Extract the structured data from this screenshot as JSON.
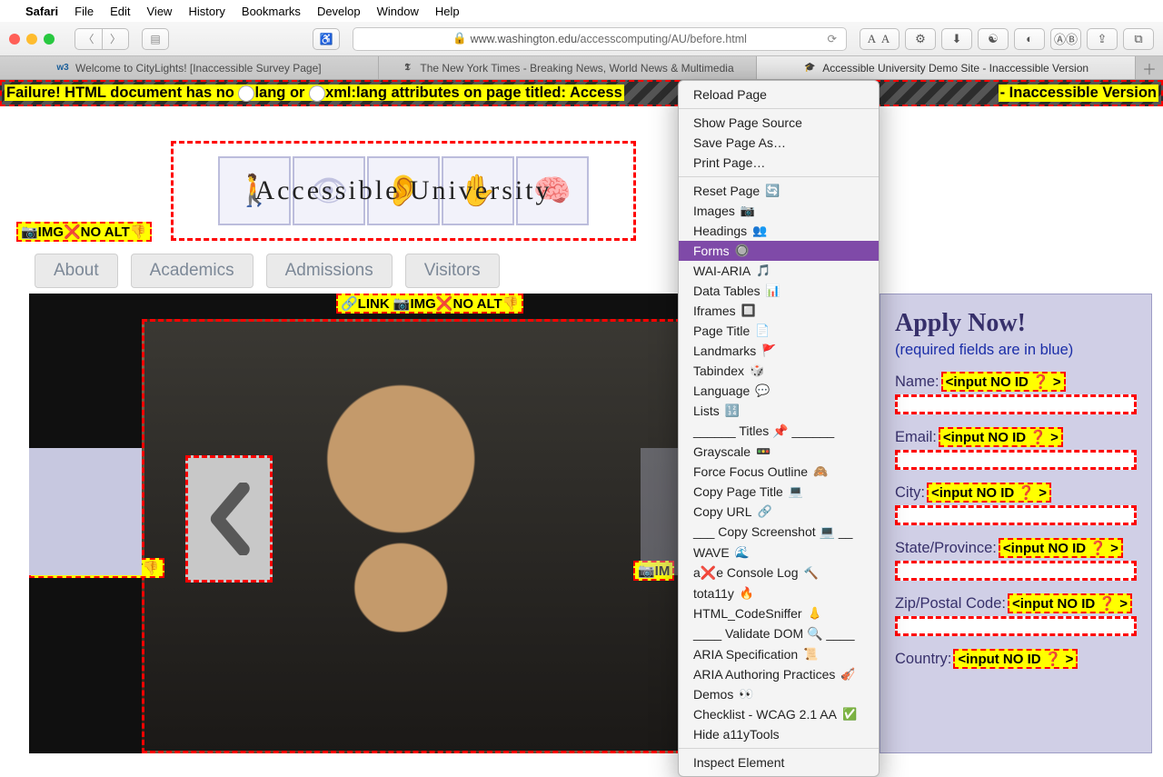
{
  "menubar": {
    "app": "Safari",
    "items": [
      "File",
      "Edit",
      "View",
      "History",
      "Bookmarks",
      "Develop",
      "Window",
      "Help"
    ]
  },
  "url": {
    "host": "www.washington.edu",
    "path": "/accesscomputing/AU/before.html"
  },
  "toolbar": {
    "aa": "A A"
  },
  "tabs": [
    {
      "fav": "w3c",
      "title": "Welcome to CityLights! [Inaccessible Survey Page]"
    },
    {
      "fav": "nyt",
      "title": "The New York Times - Breaking News, World News & Multimedia"
    },
    {
      "fav": "grad",
      "title": "Accessible University Demo Site - Inaccessible Version"
    }
  ],
  "failure": {
    "pre": "Failure! HTML document has no ",
    "mid": "lang or ",
    "post": "xml:lang attributes on page titled: Access",
    "tail": "- Inaccessible Version"
  },
  "logo_text": "Accessible University",
  "nav": [
    "About",
    "Academics",
    "Admissions",
    "Visitors"
  ],
  "badges": {
    "img_no_alt": "📷IMG❌NO ALT👎",
    "link_img_no_alt": "🔗LINK 📷IMG❌NO ALT👎",
    "input_no_id": "<input NO ID ❓ >",
    "input_no_id_wrap": "<input NO ID ❓ >"
  },
  "apply": {
    "title": "Apply Now!",
    "req": "(required fields are in blue)",
    "fields": [
      "Name:",
      "Email:",
      "City:",
      "State/Province:",
      "Zip/Postal Code:",
      "Country:"
    ]
  },
  "ctx": {
    "reload": "Reload Page",
    "group1": [
      "Show Page Source",
      "Save Page As…",
      "Print Page…"
    ],
    "tools": [
      {
        "t": "Reset Page",
        "e": "🔄"
      },
      {
        "t": "Images",
        "e": "📷"
      },
      {
        "t": "Headings",
        "e": "👥"
      },
      {
        "t": "Forms",
        "e": "🔘",
        "sel": true
      },
      {
        "t": "WAI-ARIA",
        "e": "🎵"
      },
      {
        "t": "Data Tables",
        "e": "📊"
      },
      {
        "t": "Iframes",
        "e": "🔲"
      },
      {
        "t": "Page Title",
        "e": "📄"
      },
      {
        "t": "Landmarks",
        "e": "🚩"
      },
      {
        "t": "Tabindex",
        "e": "🎲"
      },
      {
        "t": "Language",
        "e": "💬"
      },
      {
        "t": "Lists",
        "e": "🔢"
      },
      {
        "t": "______ Titles 📌 ______",
        "e": ""
      },
      {
        "t": "Grayscale",
        "e": "🚥"
      },
      {
        "t": "Force Focus Outline",
        "e": "🙈"
      },
      {
        "t": "Copy Page Title",
        "e": "💻"
      },
      {
        "t": "Copy URL",
        "e": "🔗"
      },
      {
        "t": "___ Copy Screenshot 💻 __",
        "e": ""
      },
      {
        "t": "WAVE",
        "e": "🌊"
      },
      {
        "t": "a❌e Console Log",
        "e": "🔨"
      },
      {
        "t": "tota11y",
        "e": "🔥"
      },
      {
        "t": "HTML_CodeSniffer",
        "e": "👃"
      },
      {
        "t": "____ Validate DOM 🔍 ____",
        "e": ""
      },
      {
        "t": "ARIA Specification",
        "e": "📜"
      },
      {
        "t": "ARIA Authoring Practices",
        "e": "🎻"
      },
      {
        "t": "Demos",
        "e": "👀"
      },
      {
        "t": "Checklist - WCAG 2.1 AA",
        "e": "✅"
      },
      {
        "t": "Hide a11yTools",
        "e": ""
      }
    ],
    "inspect": "Inspect Element"
  }
}
